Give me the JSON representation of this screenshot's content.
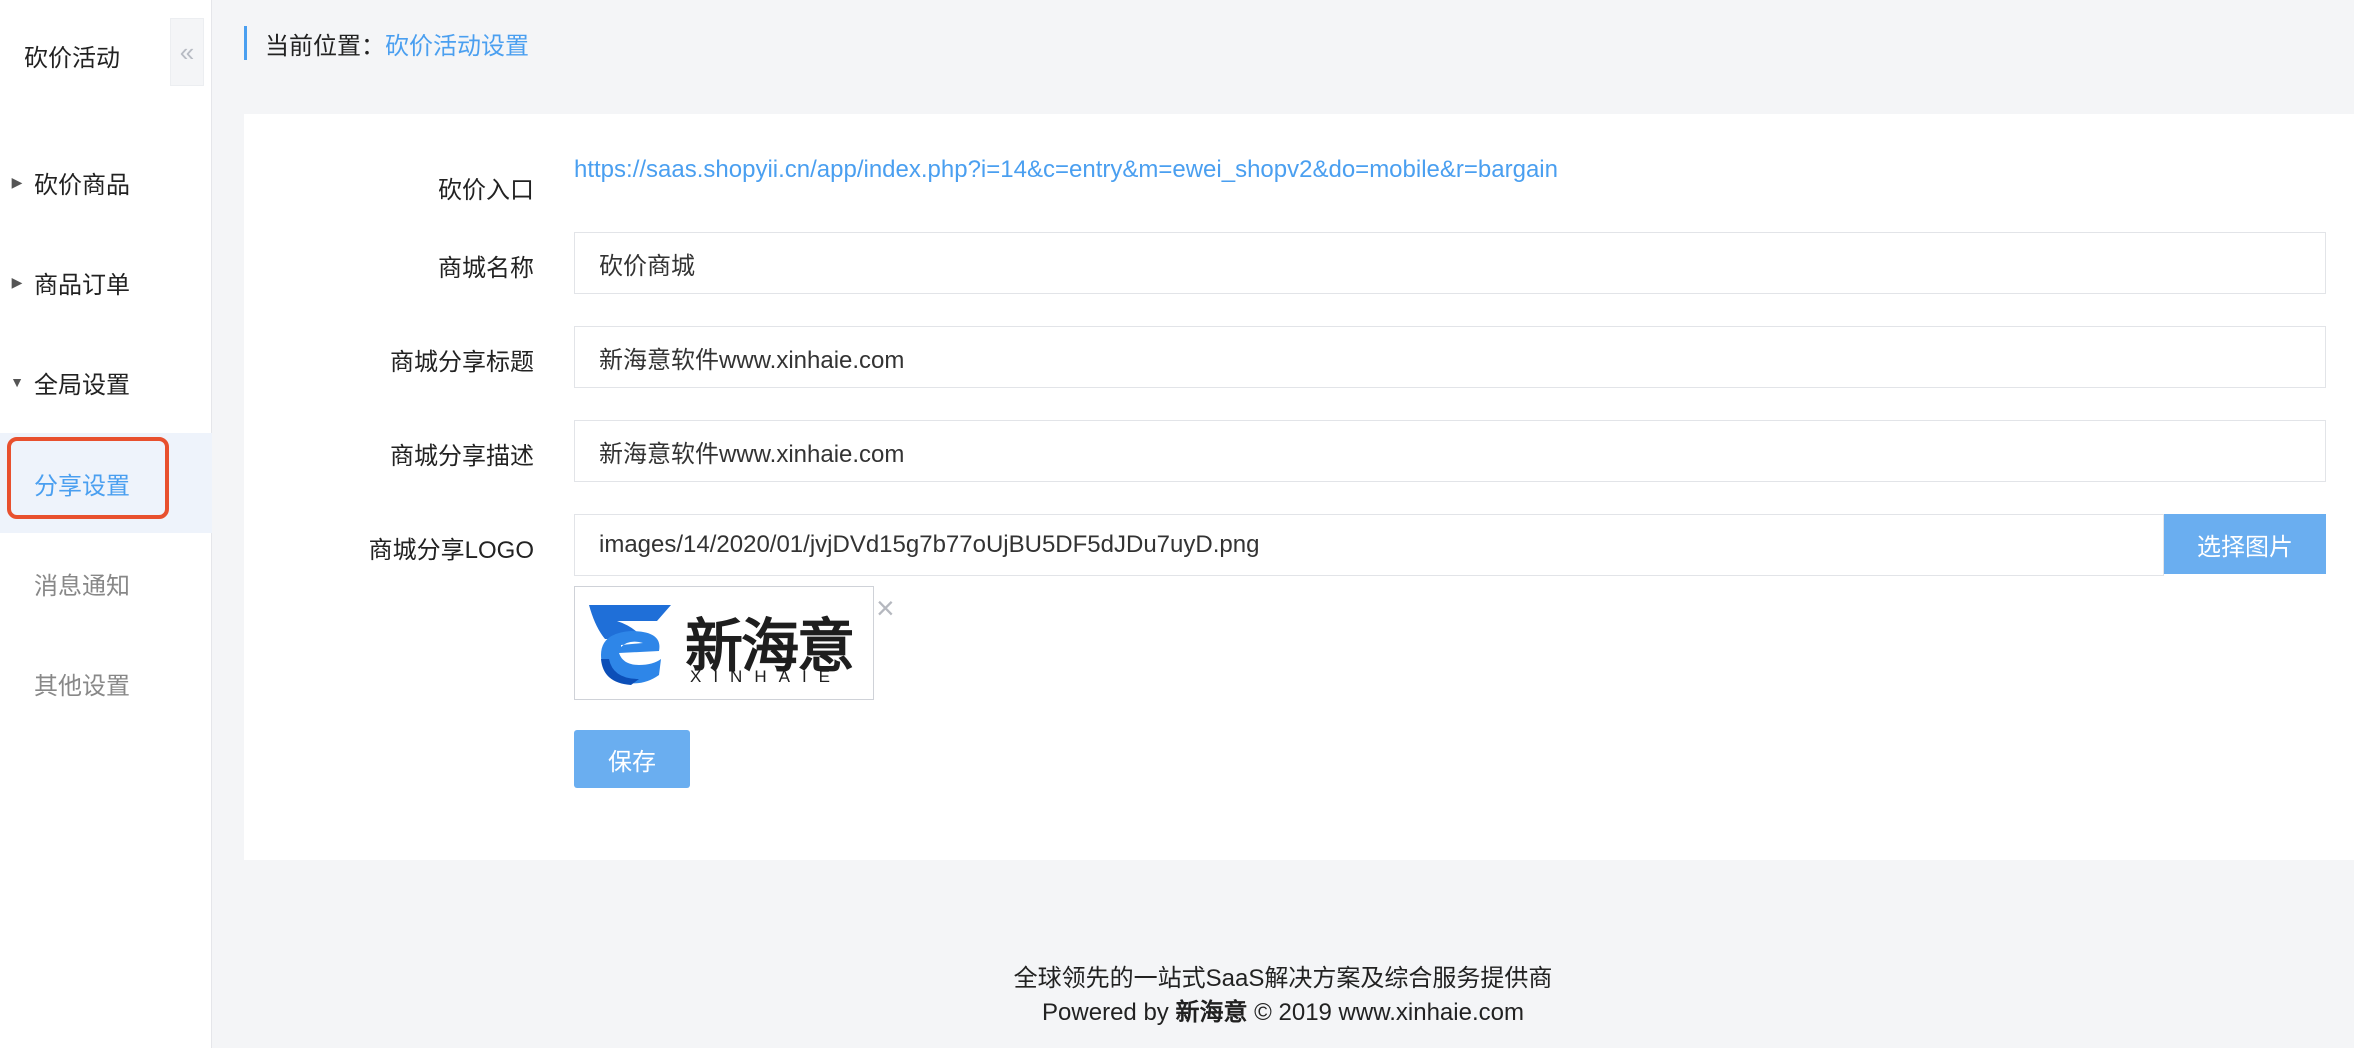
{
  "sidebar": {
    "title": "砍价活动",
    "collapse_icon": "«",
    "groups": [
      {
        "label": "砍价商品",
        "caret": "right"
      },
      {
        "label": "商品订单",
        "caret": "right"
      },
      {
        "label": "全局设置",
        "caret": "down"
      }
    ],
    "subitems": [
      {
        "label": "分享设置",
        "active": true
      },
      {
        "label": "消息通知",
        "active": false
      },
      {
        "label": "其他设置",
        "active": false
      }
    ]
  },
  "breadcrumb": {
    "prefix": "当前位置：",
    "current": "砍价活动设置"
  },
  "form": {
    "entry": {
      "label": "砍价入口",
      "url": "https://saas.shopyii.cn/app/index.php?i=14&c=entry&m=ewei_shopv2&do=mobile&r=bargain"
    },
    "shop_name": {
      "label": "商城名称",
      "value": "砍价商城"
    },
    "share_title": {
      "label": "商城分享标题",
      "value": "新海意软件www.xinhaie.com"
    },
    "share_desc": {
      "label": "商城分享描述",
      "value": "新海意软件www.xinhaie.com"
    },
    "share_logo": {
      "label": "商城分享LOGO",
      "value": "images/14/2020/01/jvjDVd15g7b77oUjBU5DF5dJDu7uyD.png",
      "select_label": "选择图片",
      "preview_brand_cn": "新海意",
      "preview_brand_en": "XINHAIE",
      "remove_icon": "×"
    },
    "save_label": "保存"
  },
  "footer": {
    "tagline": "全球领先的一站式SaaS解决方案及综合服务提供商",
    "powered_by": "Powered by",
    "brand": "新海意",
    "copyright": "© 2019 www.xinhaie.com"
  },
  "colors": {
    "accent": "#4a9ff0",
    "button": "#6aaef0",
    "highlight_outline": "#e8502e",
    "background": "#f4f5f7"
  }
}
